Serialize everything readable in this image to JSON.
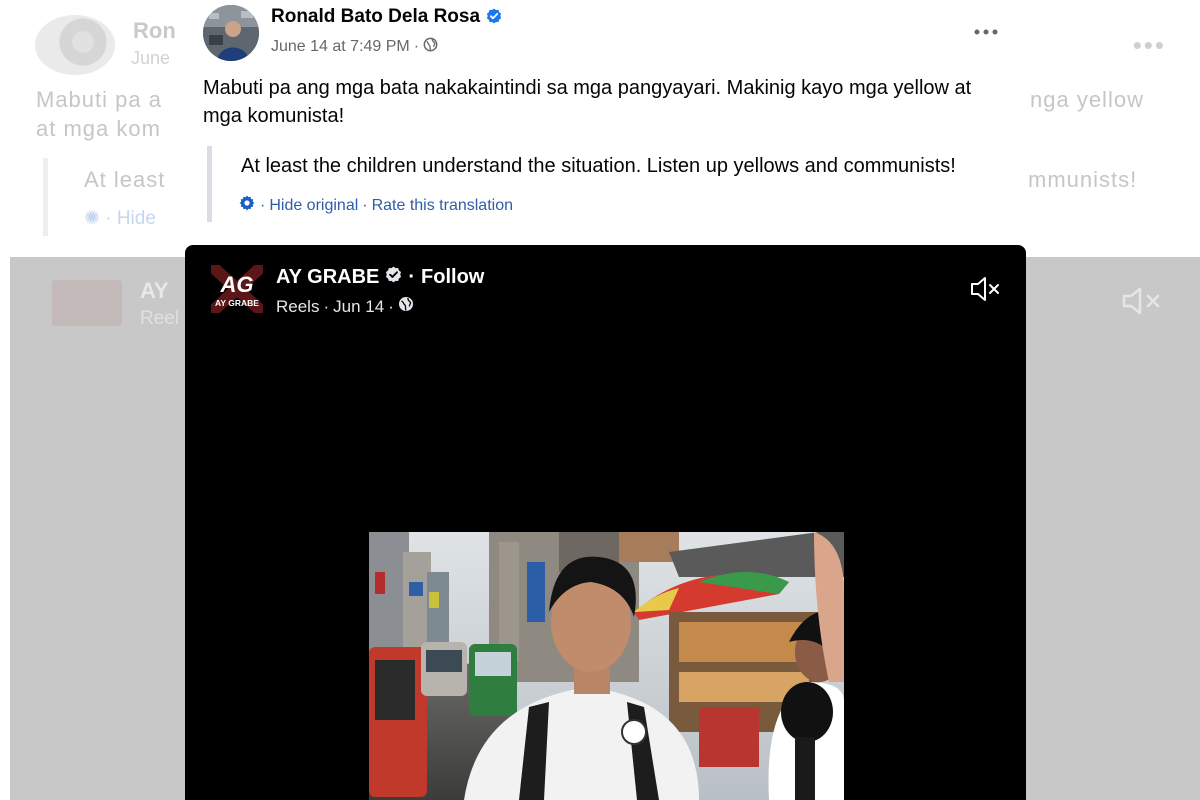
{
  "post": {
    "author": "Ronald Bato Dela Rosa",
    "date": "June 14 at 7:49 PM",
    "separator": "·",
    "text": "Mabuti pa ang mga bata nakakaintindi sa mga pangyayari. Makinig kayo mga yellow at mga komunista!",
    "translation": "At least the children understand the situation. Listen up yellows and communists!",
    "hide_original": "Hide original",
    "rate_translation": "Rate this translation",
    "icons": {
      "verified": "verified-badge-icon",
      "audience": "globe-icon",
      "more": "more-options-icon",
      "translate": "gear-icon"
    }
  },
  "background": {
    "name_fragment": "Ron",
    "date_fragment": "June",
    "line1_left": "Mabuti pa a",
    "line1_right": "nga yellow",
    "line2_left": "at mga kom",
    "quote_left": "At least",
    "quote_right": "mmunists!",
    "hide_fragment": "Hide",
    "reel_name_fragment": "AY",
    "reel_meta_fragment": "Reel"
  },
  "reel": {
    "page_name": "AY GRABE",
    "follow_label": "Follow",
    "separator": "·",
    "meta_type": "Reels",
    "meta_date": "Jun 14",
    "logo_text": "AG",
    "logo_subtext": "AY GRABE",
    "icons": {
      "verified": "verified-badge-icon",
      "audience": "globe-icon",
      "mute": "muted-speaker-icon"
    }
  },
  "colors": {
    "link": "#2f5da8",
    "verified": "#1877f2",
    "reel_background": "#000000",
    "muted_text": "#65676b"
  }
}
